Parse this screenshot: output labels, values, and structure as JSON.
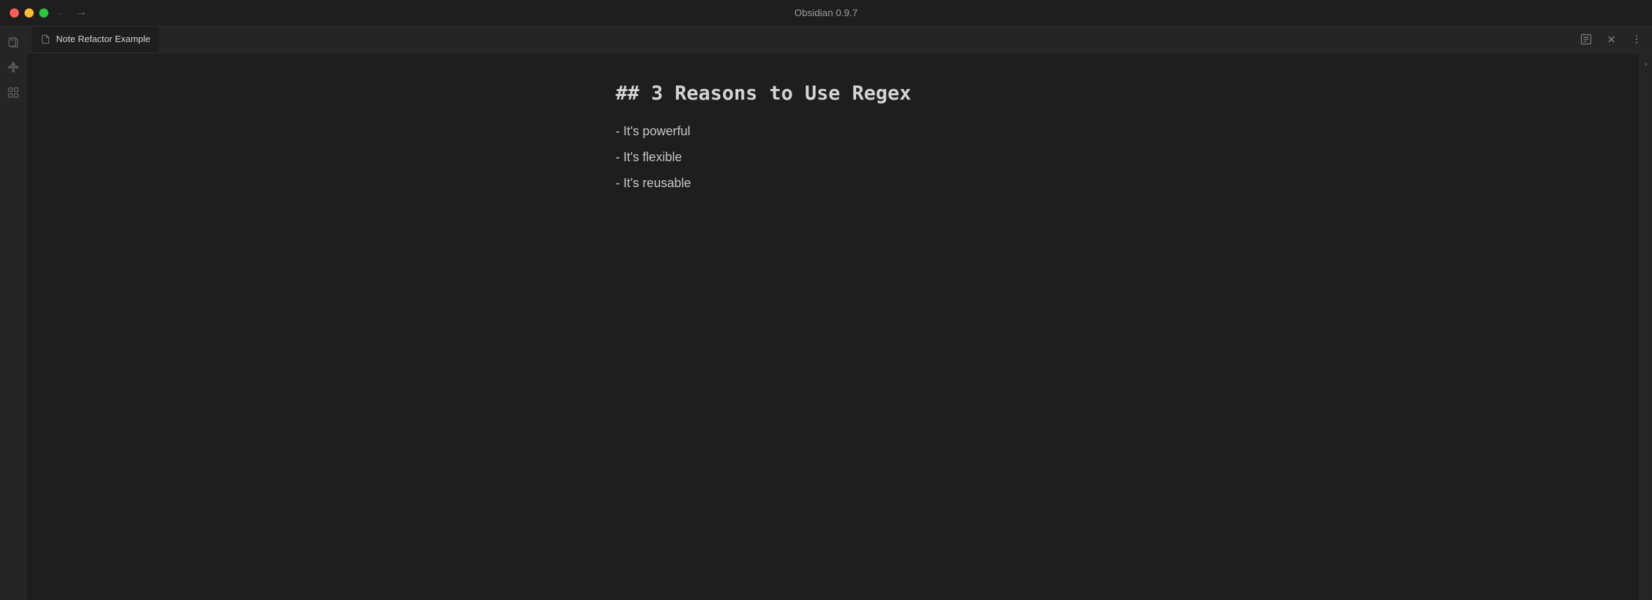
{
  "titleBar": {
    "title": "Obsidian 0.9.7"
  },
  "trafficLights": {
    "red": "red",
    "yellow": "yellow",
    "green": "green"
  },
  "nav": {
    "backDisabled": true,
    "forwardDisabled": false
  },
  "tab": {
    "label": "Note Refactor Example",
    "iconLabel": "document-icon"
  },
  "toolbar": {
    "readingViewLabel": "reading-view-icon",
    "closeLabel": "close-icon",
    "moreOptionsLabel": "more-options-icon"
  },
  "sidebar": {
    "items": [
      {
        "name": "sidebar-item-files",
        "icon": "files"
      },
      {
        "name": "sidebar-item-graph",
        "icon": "graph"
      },
      {
        "name": "sidebar-item-grid",
        "icon": "grid"
      }
    ]
  },
  "editor": {
    "heading": "## 3 Reasons to Use Regex",
    "listItems": [
      "- It's powerful",
      "- It's flexible",
      "- It's reusable"
    ]
  }
}
